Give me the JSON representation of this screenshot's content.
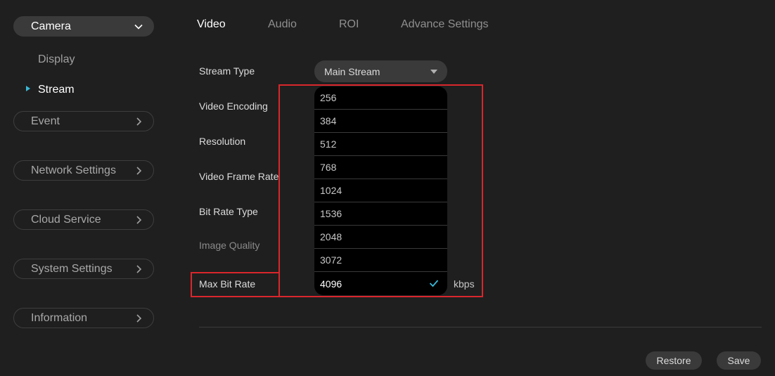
{
  "sidebar": {
    "camera_label": "Camera",
    "sub_items": [
      "Display",
      "Stream"
    ],
    "event_label": "Event",
    "network_label": "Network Settings",
    "cloud_label": "Cloud Service",
    "system_label": "System Settings",
    "information_label": "Information"
  },
  "tabs": [
    "Video",
    "Audio",
    "ROI",
    "Advance Settings"
  ],
  "form": {
    "stream_type_label": "Stream Type",
    "video_encoding_label": "Video Encoding",
    "resolution_label": "Resolution",
    "frame_rate_label": "Video Frame Rate",
    "bit_rate_type_label": "Bit Rate Type",
    "image_quality_label": "Image Quality",
    "max_bit_rate_label": "Max Bit Rate",
    "stream_type_value": "Main Stream",
    "bitrate_options": [
      "256",
      "384",
      "512",
      "768",
      "1024",
      "1536",
      "2048",
      "3072",
      "4096"
    ],
    "bitrate_unit": "kbps"
  },
  "buttons": {
    "restore": "Restore",
    "save": "Save"
  },
  "colors": {
    "accent": "#3ab8d8",
    "highlight": "#d9262c"
  }
}
